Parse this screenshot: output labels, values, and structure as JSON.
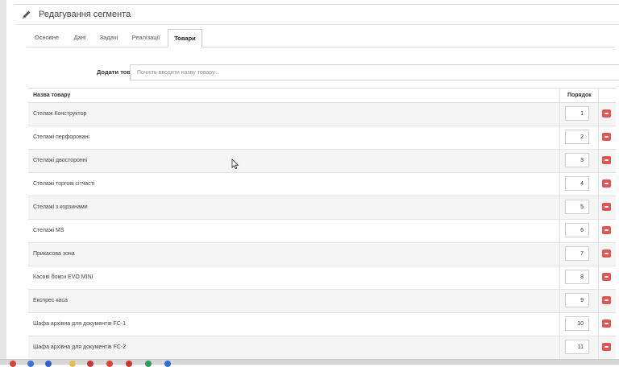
{
  "header": {
    "title": "Редагування сегмента"
  },
  "tabs": [
    {
      "label": "Основне"
    },
    {
      "label": "Дані"
    },
    {
      "label": "Задачі"
    },
    {
      "label": "Реалізації"
    },
    {
      "label": "Товари",
      "active": true
    }
  ],
  "add_product": {
    "label": "Додати товар",
    "placeholder": "Почніть вводити назву товару..."
  },
  "table": {
    "columns": {
      "name": "Назва товару",
      "order": "Порядок"
    },
    "rows": [
      {
        "name": "Стелаж Конструктор",
        "order": "1"
      },
      {
        "name": "Стелажі перфоровані",
        "order": "2"
      },
      {
        "name": "Стелажі двосторонні",
        "order": "3"
      },
      {
        "name": "Стелажі торгові сітчасті",
        "order": "4"
      },
      {
        "name": "Стелажі з корзинами",
        "order": "5"
      },
      {
        "name": "Стелажі MS",
        "order": "6"
      },
      {
        "name": "Прикасова зона",
        "order": "7"
      },
      {
        "name": "Касові бокси EVO MINI",
        "order": "8"
      },
      {
        "name": "Експрес каса",
        "order": "9"
      },
      {
        "name": "Шафа архівна для документів FC-1",
        "order": "10"
      },
      {
        "name": "Шафа архівна для документів FC-2",
        "order": "11"
      }
    ]
  },
  "colors": {
    "accent_remove": "#e15555",
    "row_alt": "#f5f5f5",
    "border": "#dcdcdc"
  }
}
